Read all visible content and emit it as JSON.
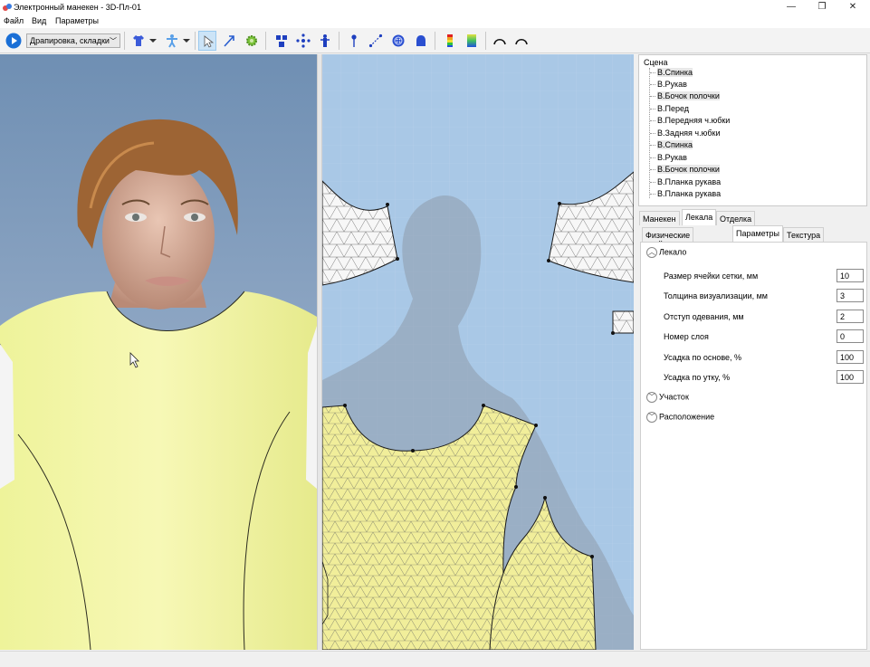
{
  "window": {
    "title": "Электронный манекен - 3D-Пл-01",
    "minimize": "—",
    "maximize": "❐",
    "close": "✕"
  },
  "menu": [
    "Файл",
    "Вид",
    "Параметры"
  ],
  "toolbar": {
    "mode": "Драпировка, складки",
    "colors": {
      "play": "#1a6fd6",
      "shirt": "#3b5bd9",
      "active_bg": "#cce4f7"
    }
  },
  "scene_tree": {
    "root": "Сцена",
    "items": [
      "В.Спинка",
      "В.Рукав",
      "В.Бочок полочки",
      "В.Перед",
      "В.Передняя ч.юбки",
      "В.Задняя ч.юбки",
      "В.Спинка",
      "В.Рукав",
      "В.Бочок полочки",
      "В.Планка рукава",
      "В.Планка рукава"
    ]
  },
  "tabs_top": [
    "Манекен",
    "Лекала",
    "Отделка"
  ],
  "tabs_sub": [
    "Физические свойства",
    "Параметры",
    "Текстура"
  ],
  "sections": {
    "lekalo": "Лекало",
    "uchastok": "Участок",
    "raspolozhenie": "Расположение"
  },
  "params": [
    {
      "label": "Размер ячейки сетки, мм",
      "value": "10"
    },
    {
      "label": "Толщина визуализации, мм",
      "value": "3"
    },
    {
      "label": "Отступ одевания, мм",
      "value": "2"
    },
    {
      "label": "Номер слоя",
      "value": "0"
    },
    {
      "label": "Усадка по основе, %",
      "value": "100"
    },
    {
      "label": "Усадка по утку, %",
      "value": "100"
    }
  ]
}
